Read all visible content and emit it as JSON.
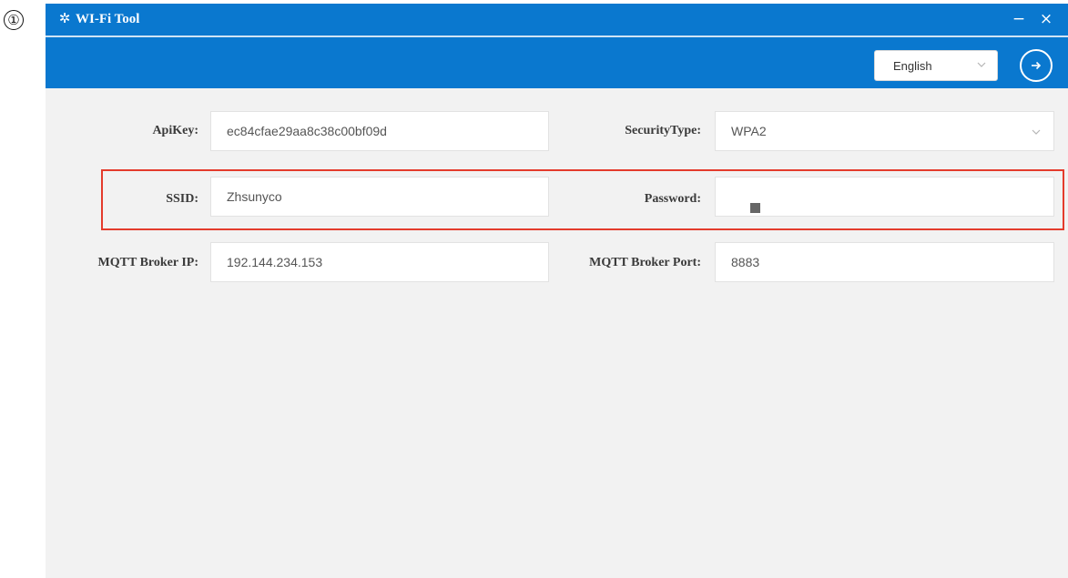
{
  "step_marker": "①",
  "window": {
    "title": "WI-Fi Tool",
    "app_icon": "spark-icon",
    "controls": {
      "minimize": "−",
      "close": "×"
    }
  },
  "toolbar": {
    "language": {
      "selected": "English",
      "icon": "chevron-down-icon"
    },
    "go_button": {
      "icon": "arrow-right-circle-icon"
    }
  },
  "form": {
    "api_key": {
      "label": "ApiKey:",
      "value": "ec84cfae29aa8c38c00bf09d"
    },
    "security_type": {
      "label": "SecurityType:",
      "value": "WPA2"
    },
    "ssid": {
      "label": "SSID:",
      "value": "Zhsunyco"
    },
    "password": {
      "label": "Password:",
      "value": ""
    },
    "mqtt_ip": {
      "label": "MQTT Broker IP:",
      "value": "192.144.234.153"
    },
    "mqtt_port": {
      "label": "MQTT Broker Port:",
      "value": "8883"
    }
  },
  "colors": {
    "header_blue": "#0a78cf",
    "background": "#f2f2f2",
    "highlight_red": "#e43b2c"
  }
}
